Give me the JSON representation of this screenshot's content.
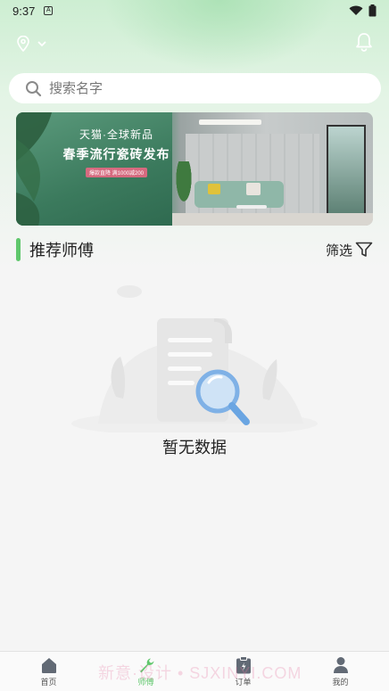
{
  "status_bar": {
    "time": "9:37",
    "notification_glyph": "A"
  },
  "search": {
    "placeholder": "搜索名字"
  },
  "banner": {
    "brand": "天猫·全球新品",
    "title": "春季流行瓷砖发布",
    "tag": "爆款直降 满1000减200"
  },
  "section": {
    "title": "推荐师傅",
    "filter_label": "筛选"
  },
  "empty_state": {
    "text": "暂无数据"
  },
  "tabs": [
    {
      "label": "首页",
      "icon": "home-icon",
      "active": false
    },
    {
      "label": "师傅",
      "icon": "wrench-icon",
      "active": true
    },
    {
      "label": "订单",
      "icon": "clipboard-icon",
      "active": false
    },
    {
      "label": "我的",
      "icon": "user-icon",
      "active": false
    }
  ],
  "watermark": "新意·设计 • SJXINYI.COM",
  "colors": {
    "accent": "#5fc76c",
    "header_green": "#cdeed2",
    "background": "#f5f5f5"
  }
}
